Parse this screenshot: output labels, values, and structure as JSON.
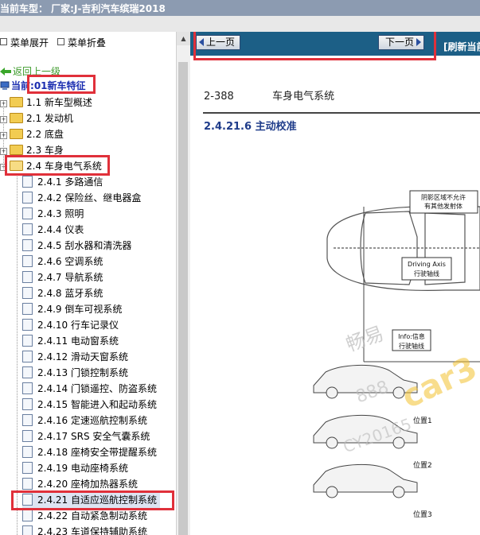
{
  "window": {
    "title": "当前车型：  厂家:J-吉利汽车缤瑞2018"
  },
  "toolbar": {
    "expand_label": "菜单展开",
    "collapse_label": "菜单折叠"
  },
  "tree": {
    "back_label": "返回上一级",
    "current_prefix": "当前",
    "current_label": ":01新车特征",
    "items": [
      {
        "label": "1.1 新车型概述"
      },
      {
        "label": "2.1 发动机"
      },
      {
        "label": "2.2 底盘"
      },
      {
        "label": "2.3 车身"
      },
      {
        "label": "2.4 车身电气系统"
      }
    ],
    "children": [
      {
        "label": "2.4.1 多路通信"
      },
      {
        "label": "2.4.2 保险丝、继电器盒"
      },
      {
        "label": "2.4.3 照明"
      },
      {
        "label": "2.4.4 仪表"
      },
      {
        "label": "2.4.5 刮水器和清洗器"
      },
      {
        "label": "2.4.6 空调系统"
      },
      {
        "label": "2.4.7 导航系统"
      },
      {
        "label": "2.4.8 蓝牙系统"
      },
      {
        "label": "2.4.9 倒车可视系统"
      },
      {
        "label": "2.4.10 行车记录仪"
      },
      {
        "label": "2.4.11 电动窗系统"
      },
      {
        "label": "2.4.12 滑动天窗系统"
      },
      {
        "label": "2.4.13 门锁控制系统"
      },
      {
        "label": "2.4.14 门锁遥控、防盗系统"
      },
      {
        "label": "2.4.15 智能进入和起动系统"
      },
      {
        "label": "2.4.16 定速巡航控制系统"
      },
      {
        "label": "2.4.17 SRS 安全气囊系统"
      },
      {
        "label": "2.4.18 座椅安全带提醒系统"
      },
      {
        "label": "2.4.19 电动座椅系统"
      },
      {
        "label": "2.4.20 座椅加热器系统"
      },
      {
        "label": "2.4.21 自适应巡航控制系统"
      },
      {
        "label": "2.4.22 自动紧急制动系统"
      },
      {
        "label": "2.4.23 车道保持辅助系统"
      }
    ]
  },
  "nav": {
    "prev_label": "上一页",
    "next_label": "下一页",
    "refresh_label": "[刷新当前"
  },
  "document": {
    "page_number": "2-388",
    "chapter": "车身电气系统",
    "section": "2.4.21.6 主动校准",
    "diagram": {
      "note_line1": "阴影区域不允许",
      "note_line2": "有其他发射体",
      "axis_en": "Driving Axis",
      "axis_cn": "行驶轴线",
      "info_line1": "Info:信息",
      "info_line2": "行驶轴线",
      "pos1": "位置1",
      "pos2": "位置2",
      "pos3": "位置3"
    },
    "watermark_1": "畅易",
    "watermark_2": "888",
    "watermark_3": "CY20165"
  },
  "colors": {
    "highlight_box": "#e0303a",
    "nav_bar": "#1c5f86",
    "title_bar": "#8c9bb1",
    "section_blue": "#1f3c8a"
  }
}
